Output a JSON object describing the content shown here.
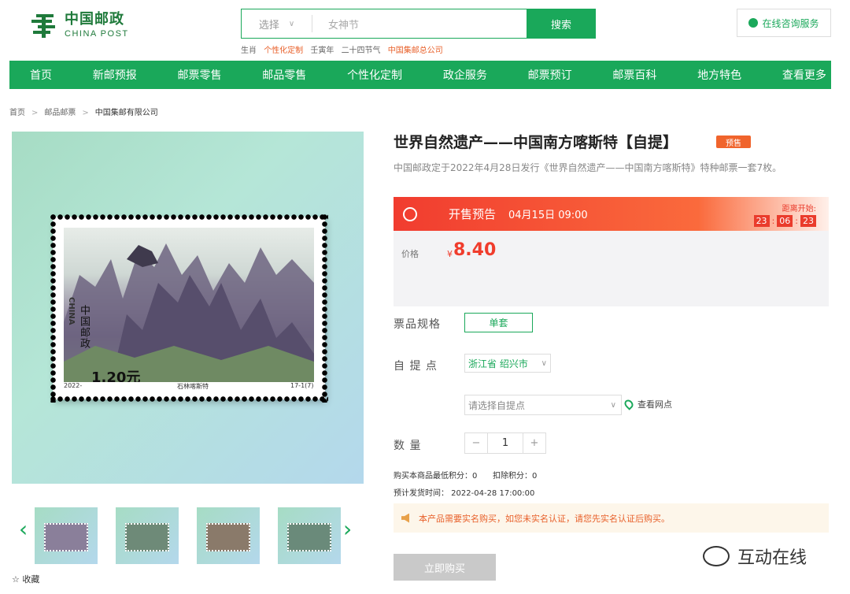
{
  "brand": {
    "cn": "中国邮政",
    "en": "CHINA POST"
  },
  "search": {
    "select_label": "选择",
    "placeholder": "女神节",
    "button": "搜索"
  },
  "hot_words": [
    "生肖",
    "个性化定制",
    "壬寅年",
    "二十四节气",
    "中国集邮总公司"
  ],
  "service_label": "在线咨询服务",
  "nav": [
    "首页",
    "新邮预报",
    "邮票零售",
    "邮品零售",
    "个性化定制",
    "政企服务",
    "邮票预订",
    "邮票百科",
    "地方特色",
    "查看更多"
  ],
  "breadcrumb": [
    "首页",
    "邮品邮票",
    "中国集邮有限公司"
  ],
  "stamp": {
    "country_cn": "中国邮政",
    "country_en": "CHINA",
    "face": "1.20元",
    "year": "2022-",
    "caption": "石林喀斯特",
    "code": "17-1(7)"
  },
  "favorite_label": "收藏",
  "product": {
    "title": "世界自然遗产——中国南方喀斯特【自提】",
    "badge": "预售",
    "description": "中国邮政定于2022年4月28日发行《世界自然遗产——中国南方喀斯特》特种邮票一套7枚。",
    "presale_label": "开售预告",
    "presale_date": "04月15日 09:00",
    "countdown_label": "距离开始:",
    "countdown": [
      "23",
      "06",
      "23"
    ],
    "price_label": "价格",
    "currency": "¥",
    "price": "8.40",
    "spec_label": "票品规格",
    "spec_option": "单套",
    "pickup_label": "自 提 点",
    "province_city": "浙江省 绍兴市",
    "pickup_placeholder": "请选择自提点",
    "view_sites": "查看网点",
    "qty_label": "数 量",
    "qty_minus": "−",
    "qty_value": "1",
    "qty_plus": "+",
    "min_points": "购买本商品最低积分：0",
    "deduct_points": "扣除积分：0",
    "ship_time": "预计发货时间： 2022-04-28 17:00:00",
    "notice": "本产品需要实名购买，如您未实名认证，请您先实名认证后购买。",
    "buy_button": "立即购买"
  },
  "watermark": "互动在线",
  "colors": {
    "primary_green": "#1aa85a",
    "accent_red": "#f03c2c",
    "accent_orange": "#e8602a"
  }
}
